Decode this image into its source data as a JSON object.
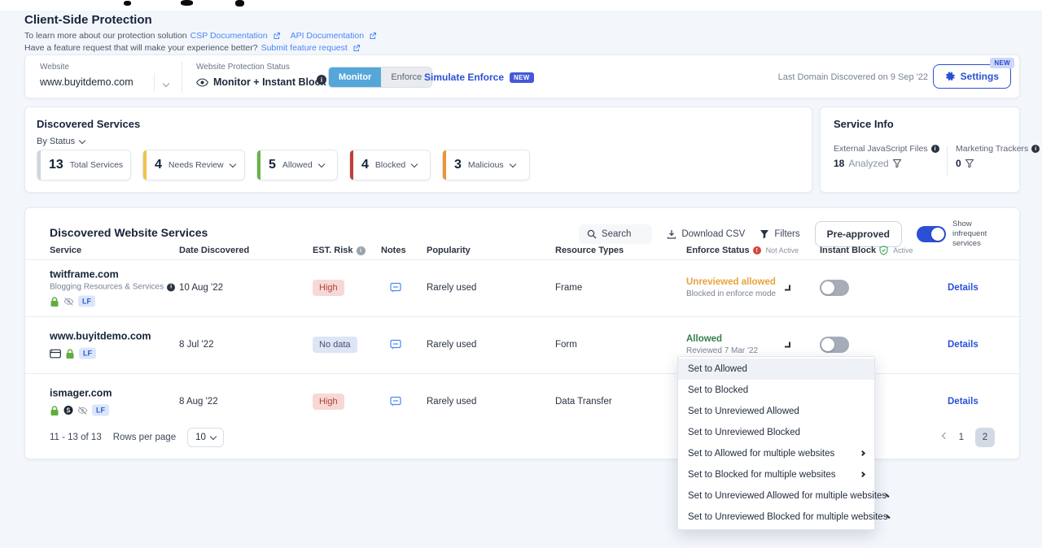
{
  "header": {
    "title": "Client-Side Protection",
    "intro_prefix": "To learn more about our protection solution",
    "csp_link": "CSP Documentation",
    "api_link": "API Documentation",
    "feature_prefix": "Have a feature request that will make your experience better?",
    "feature_link": "Submit feature request"
  },
  "website_bar": {
    "website_label": "Website",
    "website_value": "www.buyitdemo.com",
    "protection_label": "Website Protection Status",
    "protection_value": "Monitor + Instant Block",
    "monitor": "Monitor",
    "enforce": "Enforce",
    "simulate": "Simulate Enforce",
    "new_badge": "NEW",
    "last_domain": "Last Domain Discovered on 9 Sep '22",
    "settings": "Settings"
  },
  "discovered_services": {
    "title": "Discovered Services",
    "by_status": "By Status",
    "stats": [
      {
        "value": "13",
        "label": "Total Services",
        "accent": "#cfd6e0",
        "dropdown": false
      },
      {
        "value": "4",
        "label": "Needs Review",
        "accent": "#f2c249",
        "dropdown": true
      },
      {
        "value": "5",
        "label": "Allowed",
        "accent": "#67b346",
        "dropdown": true
      },
      {
        "value": "4",
        "label": "Blocked",
        "accent": "#c03f38",
        "dropdown": true
      },
      {
        "value": "3",
        "label": "Malicious",
        "accent": "#ef9434",
        "dropdown": true
      }
    ]
  },
  "service_info": {
    "title": "Service Info",
    "js_label": "External JavaScript Files",
    "js_value": "18",
    "js_suffix": "Analyzed",
    "trackers_label": "Marketing Trackers",
    "trackers_value": "0"
  },
  "table": {
    "title": "Discovered Website Services",
    "toolbar": {
      "search": "Search",
      "download": "Download CSV",
      "filters": "Filters",
      "preapproved": "Pre-approved",
      "toggle_label": "Show infrequent services"
    },
    "headers": {
      "service": "Service",
      "date": "Date Discovered",
      "risk": "EST. Risk",
      "notes": "Notes",
      "popularity": "Popularity",
      "resource": "Resource Types",
      "enforce": "Enforce Status",
      "enforce_sub": "Not Active",
      "instant": "Instant Block",
      "instant_sub": "Active"
    },
    "rows": [
      {
        "name": "twitframe.com",
        "category": "Blogging Resources & Services",
        "lf": "LF",
        "date": "10 Aug '22",
        "risk": "High",
        "popularity": "Rarely used",
        "resource": "Frame",
        "enforce_status": "Unreviewed allowed",
        "enforce_sub": "Blocked in enforce mode",
        "details": "Details"
      },
      {
        "name": "www.buyitdemo.com",
        "lf": "LF",
        "date": "8 Jul '22",
        "risk": "No data",
        "popularity": "Rarely used",
        "resource": "Form",
        "enforce_status": "Allowed",
        "enforce_sub": "Reviewed 7 Mar '22",
        "details": "Details"
      },
      {
        "name": "ismager.com",
        "lf": "LF",
        "date": "8 Aug '22",
        "risk": "High",
        "popularity": "Rarely used",
        "resource": "Data Transfer",
        "details": "Details"
      }
    ],
    "pagination": {
      "range": "11 - 13 of 13",
      "rows_per_page_label": "Rows per page",
      "rows_per_page": "10",
      "pages": [
        "1",
        "2"
      ],
      "current_page": "2"
    }
  },
  "menu": {
    "items": [
      {
        "label": "Set to Allowed",
        "submenu": false,
        "active": true
      },
      {
        "label": "Set to Blocked",
        "submenu": false,
        "active": false
      },
      {
        "label": "Set to Unreviewed Allowed",
        "submenu": false,
        "active": false
      },
      {
        "label": "Set to Unreviewed Blocked",
        "submenu": false,
        "active": false
      },
      {
        "label": "Set to Allowed for multiple websites",
        "submenu": true,
        "active": false
      },
      {
        "label": "Set to Blocked for multiple websites",
        "submenu": true,
        "active": false
      },
      {
        "label": "Set to Unreviewed Allowed for multiple websites",
        "submenu": true,
        "active": false
      },
      {
        "label": "Set to Unreviewed Blocked for multiple websites",
        "submenu": true,
        "active": false
      }
    ]
  },
  "colors": {
    "link_blue": "#4a86f7",
    "accent_blue": "#2b50d6",
    "monitor_active_blue": "#55a7d9",
    "status_amber": "#e6a23c",
    "status_green": "#35804a",
    "risk_high_bg": "#f8d8d5",
    "risk_high_text": "#ae423b",
    "risk_nodata_bg": "#dde5f6",
    "lf_badge_bg": "#dbe6fb",
    "stat_needs_review": "#f2c249",
    "stat_allowed": "#67b346",
    "stat_blocked": "#c03f38",
    "stat_malicious": "#ef9434"
  }
}
